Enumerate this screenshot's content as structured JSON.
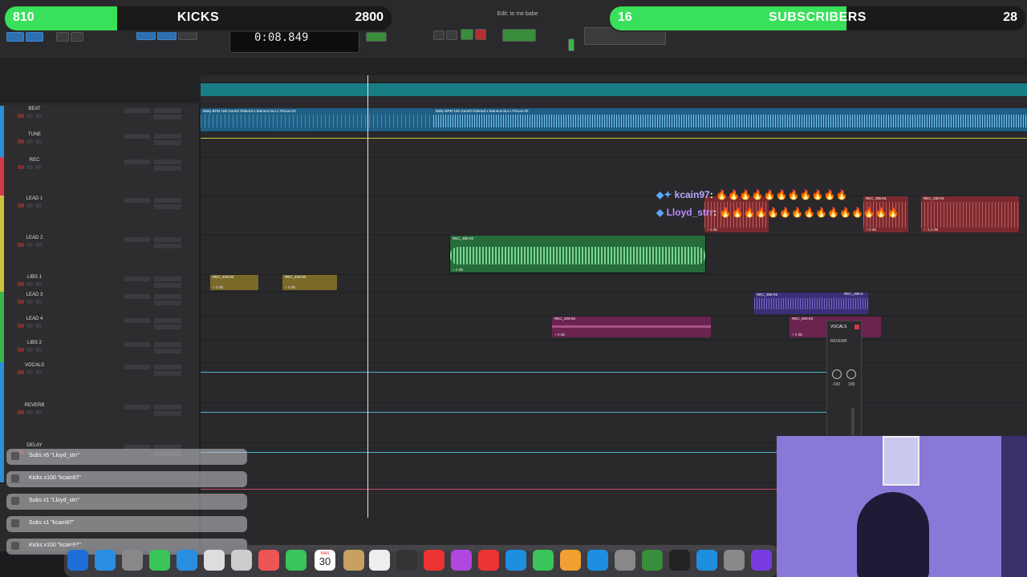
{
  "goals": {
    "kicks": {
      "left_value": "810",
      "title": "KICKS",
      "right_value": "2800",
      "progress": 0.29,
      "color": "#39e05a"
    },
    "subscribers": {
      "left_value": "16",
      "title": "SUBSCRIBERS",
      "right_value": "28",
      "progress": 0.57,
      "color": "#39e05a"
    }
  },
  "toolbar": {
    "counter": "0:08.849",
    "window_title": "Edit: to me babe"
  },
  "tracks": [
    {
      "name": "BEAT",
      "color": "#2a8fd6"
    },
    {
      "name": "TUNE",
      "color": "#2a8fd6"
    },
    {
      "name": "REC",
      "color": "#d23a4a"
    },
    {
      "name": "LEAD 1",
      "color": "#c9c23a"
    },
    {
      "name": "LEAD 2",
      "color": "#c9c23a"
    },
    {
      "name": "LIBS 1",
      "color": "#c9c23a"
    },
    {
      "name": "LEAD 3",
      "color": "#3ab54a"
    },
    {
      "name": "LEAD 4",
      "color": "#3ab54a"
    },
    {
      "name": "LIBS 2",
      "color": "#3ab54a"
    },
    {
      "name": "VOCALS",
      "color": "#2a8fd6"
    },
    {
      "name": "REVERB",
      "color": "#2a8fd6"
    },
    {
      "name": "DELAY",
      "color": "#2a8fd6"
    }
  ],
  "clips": {
    "beat_1": "Baby BPM 155 Gareth Ridered x Bianeos Boi x Pincas-03",
    "beat_2": "Baby BPM 155 Gareth Ridered x Bianeos Boi x Pincas-03",
    "lead2": "REC_365-02",
    "libs1_a": "REC_418-03",
    "libs1_b": "REC_418-03",
    "lead1_a": "REC_366-01",
    "lead1_b": "REC_330-01",
    "lead3_a": "REC_366-03",
    "lead3_b": "REC_366-0",
    "lead4_a": "REC_400-02",
    "lead4_b": "REC_400-03",
    "db_0": "+ 0 dB",
    "db_neg": "+ -1.0 dB"
  },
  "chat": [
    {
      "user": "kcain97",
      "message": "🔥🔥🔥🔥🔥🔥🔥🔥🔥🔥🔥",
      "color": "#b9a8ff"
    },
    {
      "user": "Lloyd_strr",
      "message": "🔥🔥🔥🔥🔥🔥🔥🔥🔥🔥🔥🔥🔥🔥🔥",
      "color": "#b98cff"
    }
  ],
  "notifications": [
    "Subs x5 \"Lloyd_strr\"",
    "Kicks x100 \"kcain97\"",
    "Subs x1 \"Lloyd_strr\"",
    "Subs x1 \"kcain97\"",
    "Kicks x100 \"kcain97\""
  ],
  "mixer": {
    "name": "VOCALS",
    "insert": "REVERB",
    "pan_left": "-100",
    "pan_right": "100"
  },
  "dock": {
    "calendar_day": "30",
    "calendar_month": "MAR"
  }
}
